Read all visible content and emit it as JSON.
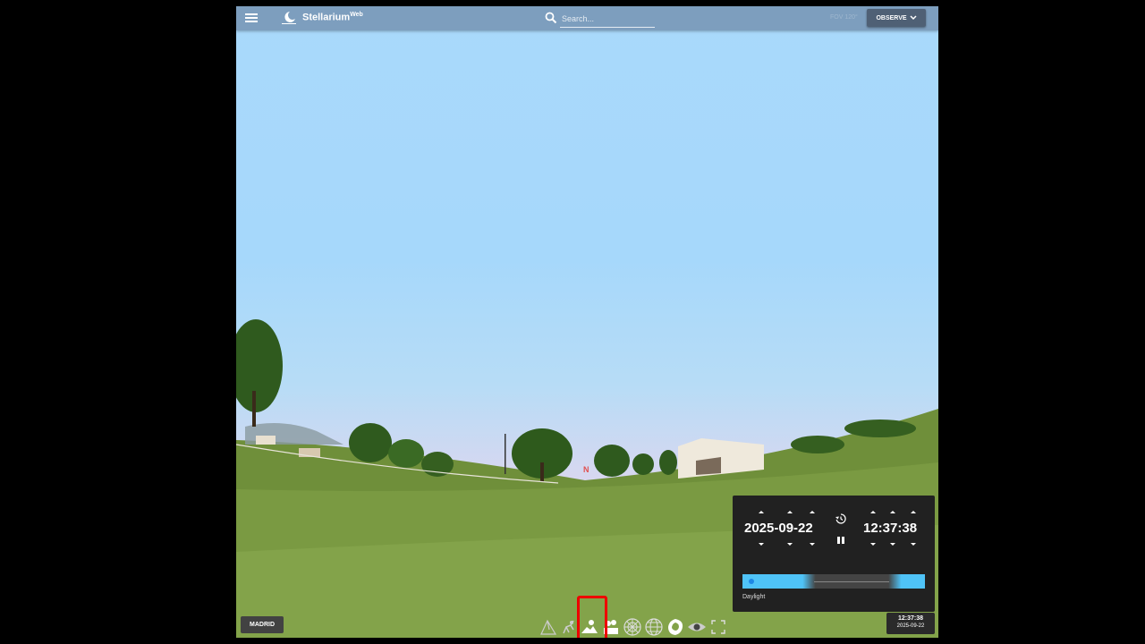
{
  "app": {
    "name": "Stellarium",
    "name_suffix": "Web"
  },
  "search": {
    "placeholder": "Search..."
  },
  "header": {
    "fov_label": "FOV 120°",
    "observe_label": "OBSERVE"
  },
  "location": {
    "label": "MADRID"
  },
  "time_panel": {
    "date": "2025-09-22",
    "time": "12:37:38",
    "period_label": "Daylight"
  },
  "clock": {
    "time": "12:37:38",
    "date": "2025-09-22"
  },
  "compass": {
    "north_label": "N"
  },
  "toolbar": {
    "icons": [
      "constellation-lines-icon",
      "constellation-art-icon",
      "landscape-icon",
      "atmosphere-icon",
      "azimuthal-grid-icon",
      "equatorial-grid-icon",
      "deep-sky-objects-icon",
      "night-mode-icon",
      "fullscreen-icon"
    ],
    "selected": "landscape-icon"
  },
  "colors": {
    "sky": "#a9d9fb",
    "panel": "#212121",
    "accent": "#4fc3f7",
    "highlight": "#e00000"
  }
}
